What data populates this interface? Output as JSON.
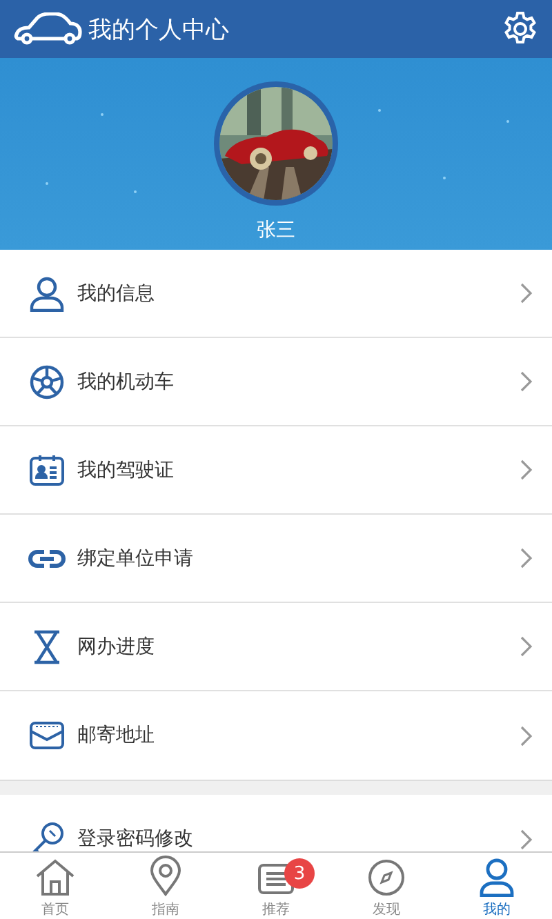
{
  "header": {
    "title": "我的个人中心"
  },
  "profile": {
    "name": "张三"
  },
  "menu_groups": [
    {
      "items": [
        {
          "label": "我的信息"
        },
        {
          "label": "我的机动车"
        },
        {
          "label": "我的驾驶证"
        },
        {
          "label": "绑定单位申请"
        },
        {
          "label": "网办进度"
        },
        {
          "label": "邮寄地址"
        }
      ]
    },
    {
      "items": [
        {
          "label": "登录密码修改"
        }
      ]
    }
  ],
  "tab_bar": [
    {
      "label": "首页",
      "selected": false
    },
    {
      "label": "指南",
      "selected": false
    },
    {
      "label": "推荐",
      "selected": false,
      "badge": "3"
    },
    {
      "label": "发现",
      "selected": false
    },
    {
      "label": "我的",
      "selected": true
    }
  ]
}
